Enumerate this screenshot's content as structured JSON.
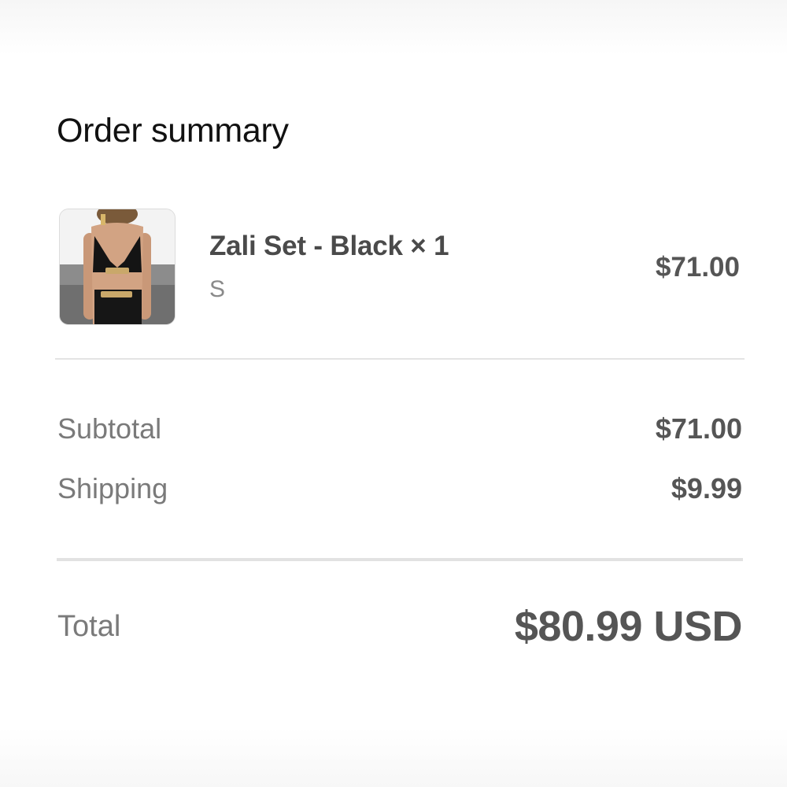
{
  "order_summary": {
    "title": "Order summary",
    "item": {
      "name": "Zali Set - Black × 1",
      "variant": "S",
      "price": "$71.00"
    },
    "subtotal": {
      "label": "Subtotal",
      "value": "$71.00"
    },
    "shipping": {
      "label": "Shipping",
      "value": "$9.99"
    },
    "total": {
      "label": "Total",
      "value": "$80.99 USD"
    }
  },
  "colors": {
    "heading": "#111111",
    "price_text": "#555555",
    "label_text": "#7a7a7a",
    "divider": "#e4e4e4"
  }
}
